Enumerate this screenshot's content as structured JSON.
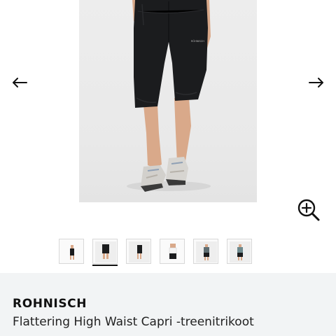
{
  "gallery": {
    "prev_icon": "arrow-left-icon",
    "next_icon": "arrow-right-icon",
    "zoom_icon": "zoom-in-icon",
    "image_count": 6,
    "active_index": 1
  },
  "product": {
    "brand": "ROHNISCH",
    "title": "Flattering High Waist Capri -treenitrikoot"
  },
  "colors": {
    "info_bg": "#f2f4f5",
    "tights": "#1b1c1e",
    "skin": "#d9a98a",
    "active_indicator": "#111111"
  }
}
